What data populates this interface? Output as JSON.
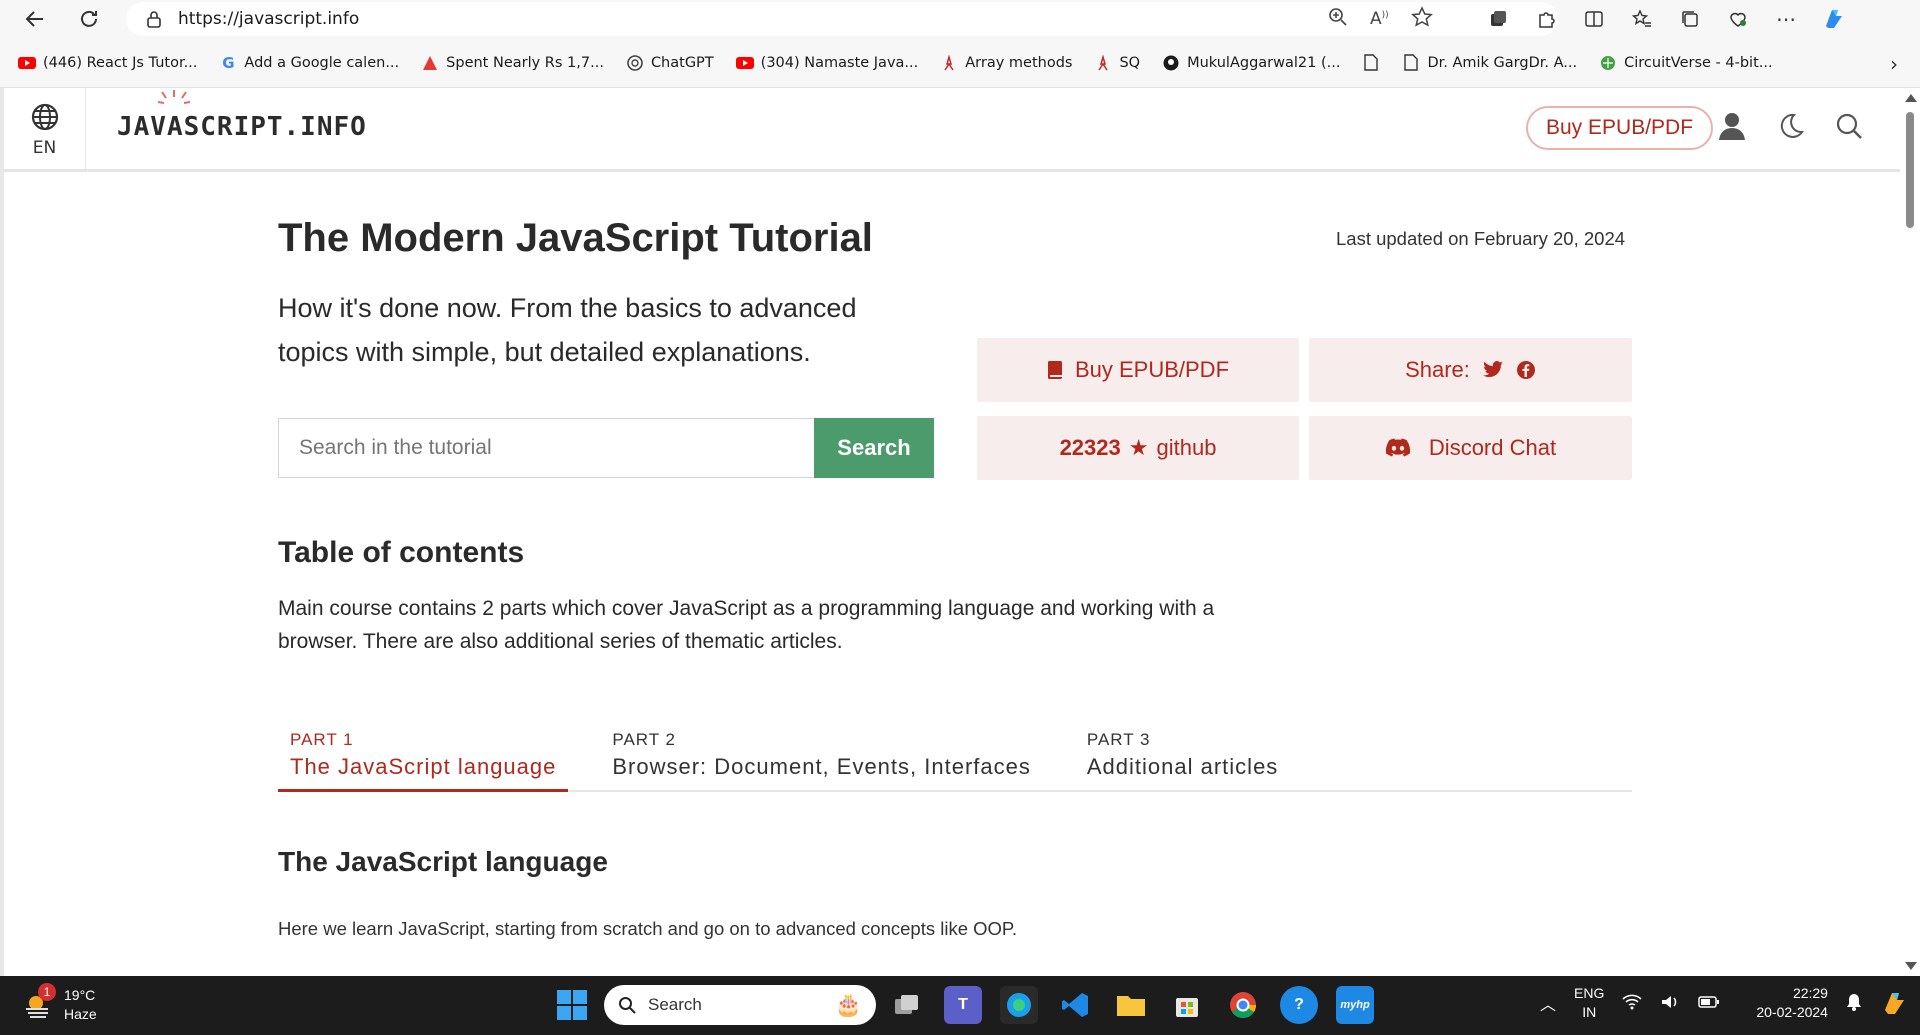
{
  "browser": {
    "url": "https://javascript.info",
    "bookmarks": [
      {
        "label": "(446) React Js Tutor...",
        "icon": "youtube-icon"
      },
      {
        "label": "Add a Google calen...",
        "icon": "google-icon"
      },
      {
        "label": "Spent Nearly Rs 1,7...",
        "icon": "red-triangle-icon"
      },
      {
        "label": "ChatGPT",
        "icon": "chatgpt-icon"
      },
      {
        "label": "(304) Namaste Java...",
        "icon": "youtube-icon"
      },
      {
        "label": "Array methods",
        "icon": "javascript-info-icon"
      },
      {
        "label": "SQ",
        "icon": "javascript-info-icon"
      },
      {
        "label": "MukulAggarwal21 (...",
        "icon": "github-icon"
      },
      {
        "label": "",
        "icon": "document-icon"
      },
      {
        "label": "Dr. Amik GargDr. A...",
        "icon": "document-icon"
      },
      {
        "label": "CircuitVerse - 4-bit...",
        "icon": "circuitverse-icon"
      }
    ]
  },
  "header": {
    "lang": "EN",
    "logo": "JAVASCRIPT.INFO",
    "buy_label": "Buy EPUB/PDF"
  },
  "main": {
    "title": "The Modern JavaScript Tutorial",
    "last_updated": "Last updated on February 20, 2024",
    "tagline": "How it's done now. From the basics to advanced topics with simple, but detailed explanations.",
    "search_placeholder": "Search in the tutorial",
    "search_button": "Search",
    "cards": {
      "buy": "Buy EPUB/PDF",
      "share": "Share:",
      "github_count": "22323",
      "github_star": "★",
      "github_label": "github",
      "discord": "Discord Chat"
    },
    "toc_title": "Table of contents",
    "toc_desc": "Main course contains 2 parts which cover JavaScript as a programming language and working with a browser. There are also additional series of thematic articles.",
    "tabs": [
      {
        "num": "PART 1",
        "label": "The JavaScript language"
      },
      {
        "num": "PART 2",
        "label": "Browser: Document, Events, Interfaces"
      },
      {
        "num": "PART 3",
        "label": "Additional articles"
      }
    ],
    "section_title": "The JavaScript language",
    "section_desc": "Here we learn JavaScript, starting from scratch and go on to advanced concepts like OOP."
  },
  "taskbar": {
    "weather_badge": "1",
    "temperature": "19°C",
    "condition": "Haze",
    "search_label": "Search",
    "lang_top": "ENG",
    "lang_bottom": "IN",
    "time": "22:29",
    "date": "20-02-2024"
  },
  "colors": {
    "accent": "#b1281c",
    "search_green": "#4b9b6c",
    "card_bg": "#f7eded"
  }
}
